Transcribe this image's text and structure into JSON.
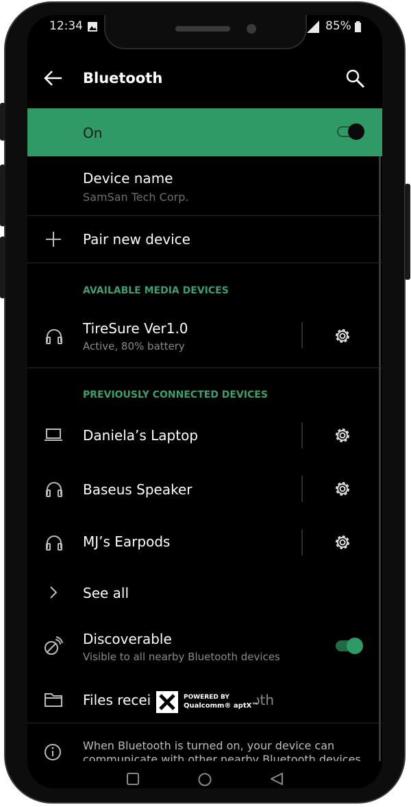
{
  "status_bar": {
    "time": "12:34",
    "battery": "85%"
  },
  "app_bar": {
    "title": "Bluetooth"
  },
  "toggle_row": {
    "label": "On"
  },
  "device_name": {
    "label": "Device name",
    "value": "SamSan Tech Corp."
  },
  "pair_new": {
    "label": "Pair new device"
  },
  "available_section": {
    "header": "AVAILABLE MEDIA DEVICES"
  },
  "available_devices": [
    {
      "name": "TireSure Ver1.0",
      "status": "Active, 80% battery"
    }
  ],
  "previous_section": {
    "header": "PREVIOUSLY CONNECTED DEVICES"
  },
  "previous_devices": [
    {
      "name": "Daniela’s Laptop"
    },
    {
      "name": "Baseus Speaker"
    },
    {
      "name": "MJ’s Earpods"
    }
  ],
  "see_all": {
    "label": "See all"
  },
  "discoverable": {
    "label": "Discoverable",
    "sub": "Visible to all nearby Bluetooth devices"
  },
  "files_received": {
    "label_left": "Files recei",
    "label_right": "via bluetooth"
  },
  "aptx_badge": {
    "line1": "POWERED BY",
    "line2": "Qualcomm® aptX™"
  },
  "info": {
    "text": "When Bluetooth is turned on, your device can",
    "text2": "communicate with other nearby Bluetooth devices."
  },
  "colors": {
    "accent": "#2f9a66",
    "section": "#3e9e6e",
    "background": "#000000"
  }
}
